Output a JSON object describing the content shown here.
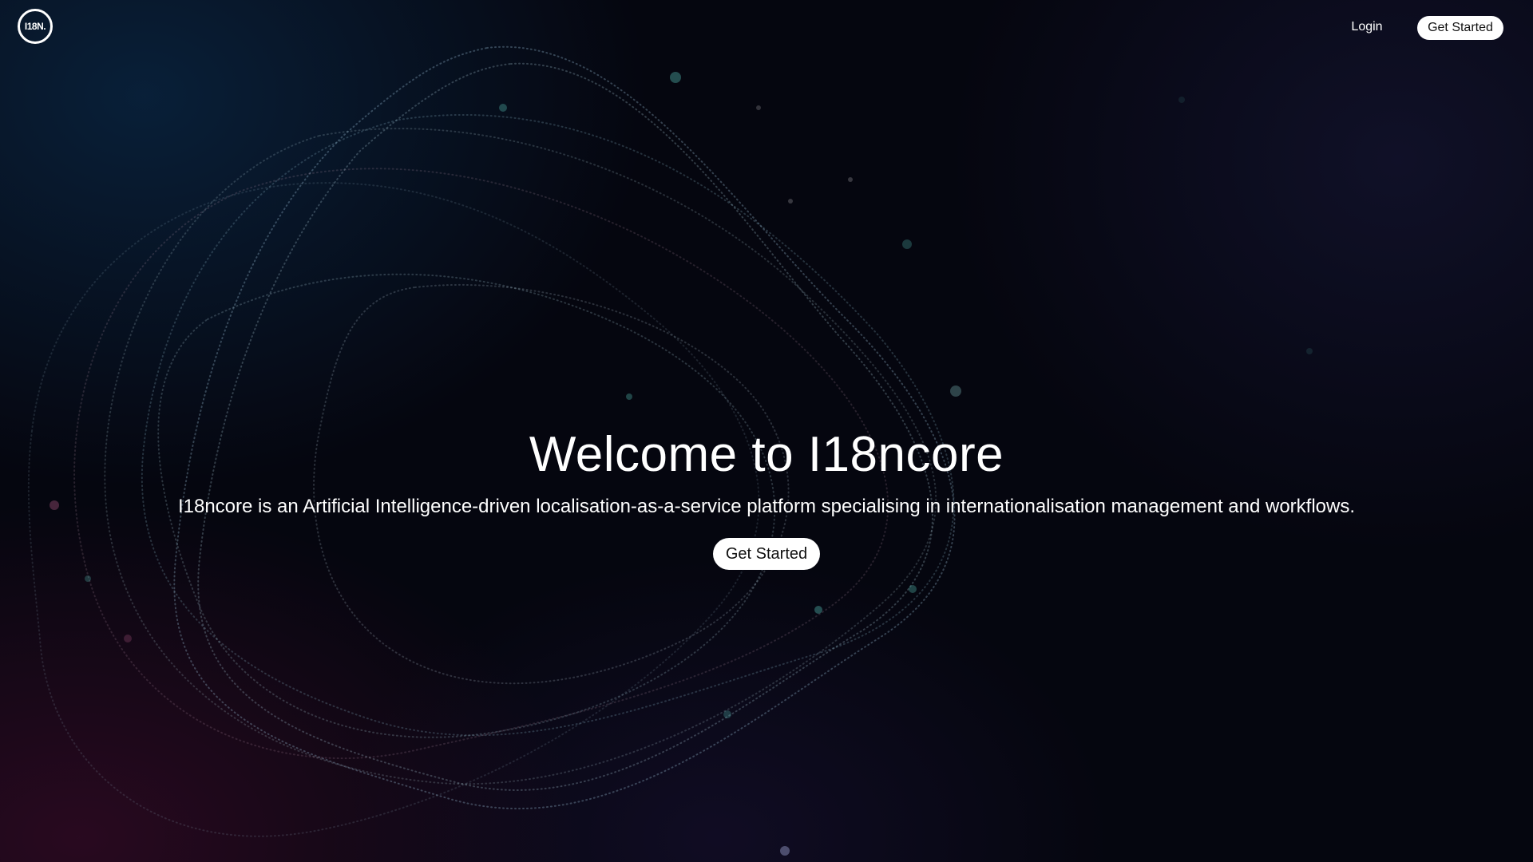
{
  "brand": {
    "logo_text": "I18N."
  },
  "nav": {
    "login_label": "Login",
    "cta_label": "Get Started"
  },
  "hero": {
    "title": "Welcome to I18ncore",
    "subtitle": "I18ncore is an Artificial Intelligence-driven localisation-as-a-service platform specialising in internationalisation management and workflows.",
    "cta_label": "Get Started"
  },
  "colors": {
    "background": "#05060f",
    "text": "#ffffff",
    "button_bg": "#ffffff",
    "button_text": "#111111",
    "particle_teal": "#5fd3c8",
    "particle_pink": "#c06090"
  }
}
